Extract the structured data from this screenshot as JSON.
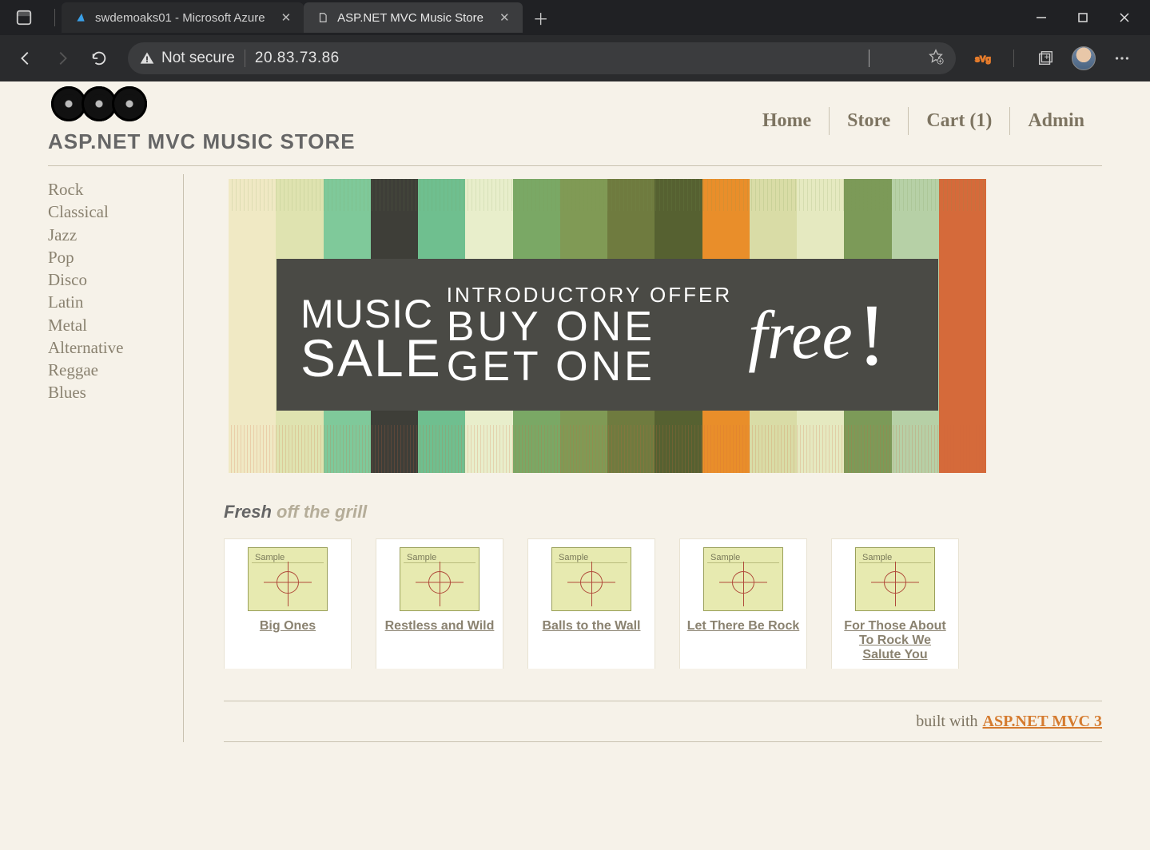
{
  "browser": {
    "tabs": [
      {
        "title": "swdemoaks01 - Microsoft Azure",
        "active": false
      },
      {
        "title": "ASP.NET MVC Music Store",
        "active": true
      }
    ],
    "security_label": "Not secure",
    "url": "20.83.73.86"
  },
  "site": {
    "title": "ASP.NET MVC MUSIC STORE",
    "nav": {
      "home": "Home",
      "store": "Store",
      "cart": "Cart (1)",
      "admin": "Admin"
    }
  },
  "sidebar": {
    "genres": [
      "Rock",
      "Classical",
      "Jazz",
      "Pop",
      "Disco",
      "Latin",
      "Metal",
      "Alternative",
      "Reggae",
      "Blues"
    ]
  },
  "promo": {
    "left_top": "MUSIC",
    "left_bottom": "SALE",
    "mid_top": "INTRODUCTORY OFFER",
    "mid_mid": "BUY ONE",
    "mid_bot": "GET ONE",
    "right": "free",
    "excl": "!",
    "stripe_colors": [
      "#f0e9c4",
      "#dfe3b0",
      "#7fc99a",
      "#3e3e38",
      "#6fbf8f",
      "#e8eecb",
      "#7aa865",
      "#809a55",
      "#6f7b3f",
      "#566131",
      "#e98e2a",
      "#d9dca6",
      "#e5e9c0",
      "#7c9a58",
      "#b6d0a6",
      "#d56a3a"
    ]
  },
  "fresh": {
    "bold": "Fresh",
    "rest": " off the grill"
  },
  "albums": [
    {
      "sample": "Sample",
      "title": "Big Ones"
    },
    {
      "sample": "Sample",
      "title": "Restless and Wild"
    },
    {
      "sample": "Sample",
      "title": "Balls to the Wall"
    },
    {
      "sample": "Sample",
      "title": "Let There Be Rock"
    },
    {
      "sample": "Sample",
      "title": "For Those About To Rock We Salute You"
    }
  ],
  "footer": {
    "text": "built with",
    "link": "ASP.NET MVC 3"
  }
}
